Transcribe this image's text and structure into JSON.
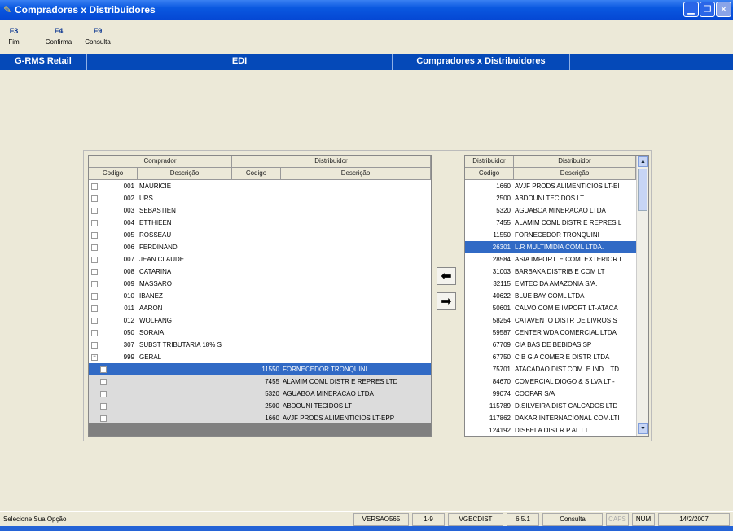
{
  "window": {
    "title": "Compradores x Distribuidores"
  },
  "fkeys": [
    {
      "key": "F3",
      "label": "Fim"
    },
    {
      "key": "F4",
      "label": "Confirma"
    },
    {
      "key": "F9",
      "label": "Consulta"
    }
  ],
  "nav": {
    "app": "G-RMS Retail",
    "module": "EDI",
    "screen": "Compradores x Distribuidores"
  },
  "left_grid": {
    "group_headers": {
      "comprador": "Comprador",
      "distribuidor": "Distribuidor"
    },
    "col_headers": {
      "codigo": "Codigo",
      "descricao": "Descrição",
      "codigo2": "Codigo",
      "descricao2": "Descrição"
    },
    "rows": [
      {
        "cod": "001",
        "desc": "MAURICIE"
      },
      {
        "cod": "002",
        "desc": "URS"
      },
      {
        "cod": "003",
        "desc": "SEBASTIEN"
      },
      {
        "cod": "004",
        "desc": "ETTHIEEN"
      },
      {
        "cod": "005",
        "desc": "ROSSEAU"
      },
      {
        "cod": "006",
        "desc": "FERDINAND"
      },
      {
        "cod": "007",
        "desc": "JEAN CLAUDE"
      },
      {
        "cod": "008",
        "desc": "CATARINA"
      },
      {
        "cod": "009",
        "desc": "MASSARO"
      },
      {
        "cod": "010",
        "desc": "IBANEZ"
      },
      {
        "cod": "011",
        "desc": "AARON"
      },
      {
        "cod": "012",
        "desc": "WOLFANG"
      },
      {
        "cod": "050",
        "desc": "SORAIA"
      },
      {
        "cod": "307",
        "desc": "SUBST TRIBUTARIA 18% S"
      },
      {
        "cod": "999",
        "desc": "GERAL"
      }
    ],
    "sub_rows": [
      {
        "cod": "11550",
        "desc": "FORNECEDOR TRONQUINI"
      },
      {
        "cod": "7455",
        "desc": "ALAMIM COML DISTR E REPRES LTD"
      },
      {
        "cod": "5320",
        "desc": "AGUABOA MINERACAO LTDA"
      },
      {
        "cod": "2500",
        "desc": "ABDOUNI TECIDOS LT"
      },
      {
        "cod": "1660",
        "desc": "AVJF PRODS ALIMENTICIOS LT-EPP"
      }
    ]
  },
  "right_grid": {
    "headers": {
      "top1": "Distribuidor",
      "top2": "Distribuidor",
      "col1": "Codigo",
      "col2": "Descrição"
    },
    "rows": [
      {
        "cod": "1660",
        "desc": "AVJF PRODS ALIMENTICIOS LT-EI"
      },
      {
        "cod": "2500",
        "desc": "ABDOUNI TECIDOS LT"
      },
      {
        "cod": "5320",
        "desc": "AGUABOA MINERACAO LTDA"
      },
      {
        "cod": "7455",
        "desc": "ALAMIM COML DISTR E REPRES L"
      },
      {
        "cod": "11550",
        "desc": "FORNECEDOR TRONQUINI"
      },
      {
        "cod": "26301",
        "desc": "L.R MULTIMIDIA COML LTDA."
      },
      {
        "cod": "28584",
        "desc": "ASIA IMPORT. E COM. EXTERIOR L"
      },
      {
        "cod": "31003",
        "desc": "BARBAKA DISTRIB E COM LT"
      },
      {
        "cod": "32115",
        "desc": "EMTEC DA AMAZONIA S/A."
      },
      {
        "cod": "40622",
        "desc": "BLUE BAY COML LTDA"
      },
      {
        "cod": "50601",
        "desc": "CALVO COM E IMPORT LT-ATACA"
      },
      {
        "cod": "58254",
        "desc": "CATAVENTO DISTR DE LIVROS S"
      },
      {
        "cod": "59587",
        "desc": "CENTER WDA COMERCIAL LTDA"
      },
      {
        "cod": "67709",
        "desc": "CIA BAS DE BEBIDAS SP"
      },
      {
        "cod": "67750",
        "desc": "C B G A COMER E DISTR LTDA"
      },
      {
        "cod": "75701",
        "desc": "ATACADAO DIST.COM. E IND. LTD"
      },
      {
        "cod": "84670",
        "desc": "COMERCIAL DIOGO & SILVA LT -"
      },
      {
        "cod": "99074",
        "desc": "COOPAR S/A"
      },
      {
        "cod": "115789",
        "desc": "D.SILVEIRA DIST CALCADOS LTD"
      },
      {
        "cod": "117862",
        "desc": "DAKAR INTERNACIONAL COM.LTI"
      },
      {
        "cod": "124192",
        "desc": "DISBELA DIST.R.P.AL.LT"
      }
    ]
  },
  "status": {
    "message": "Selecione Sua Opção",
    "panels": [
      "VERSAO565",
      "1-9",
      "VGECDIST",
      "6.5.1",
      "Consulta",
      "CAPS",
      "NUM",
      "14/2/2007"
    ]
  },
  "colors": {
    "selection": "#316AC5",
    "titlebar": "#0A58E0",
    "navbar": "#0549B8"
  }
}
